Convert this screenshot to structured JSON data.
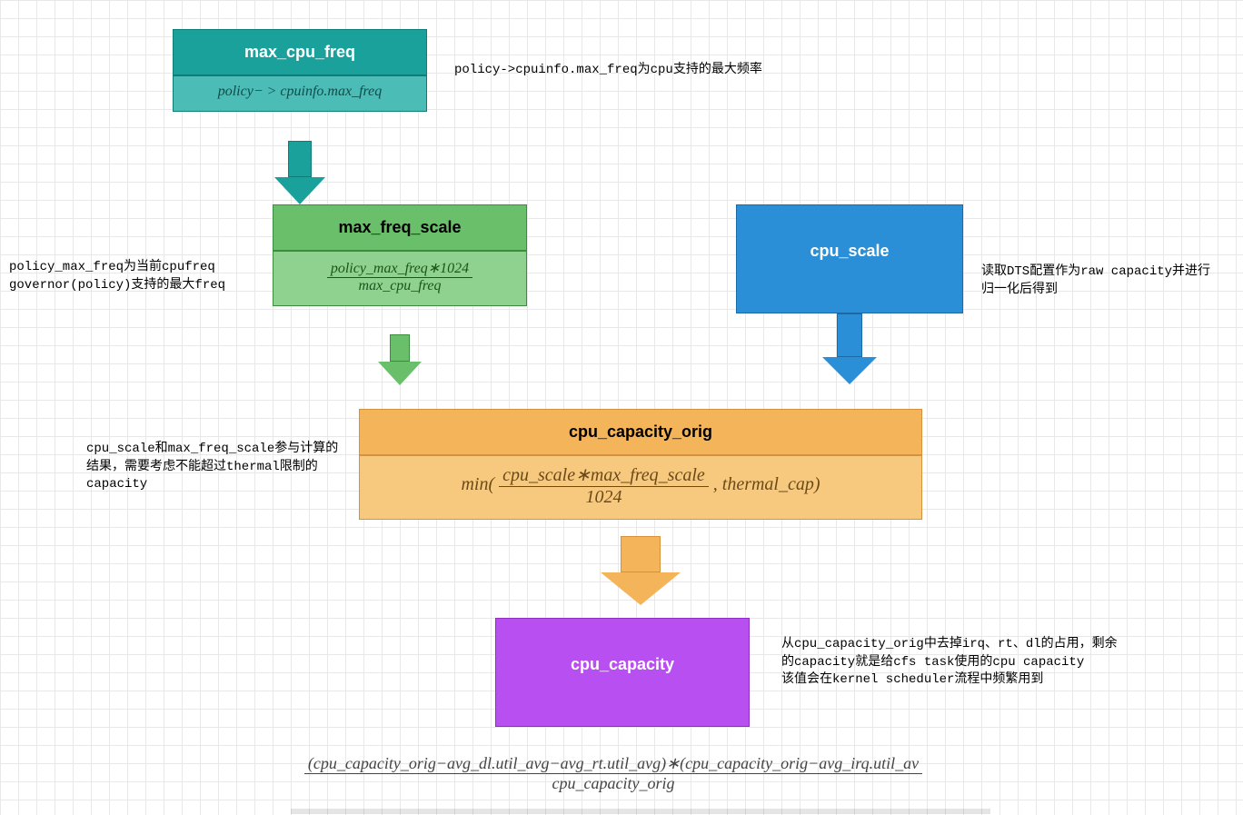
{
  "nodes": {
    "max_cpu_freq": {
      "title": "max_cpu_freq",
      "formula_num": "policy− > cpuinfo.max_freq"
    },
    "max_freq_scale": {
      "title": "max_freq_scale",
      "formula_num": "policy_max_freq∗1024",
      "formula_den": "max_cpu_freq"
    },
    "cpu_scale": {
      "title": "cpu_scale"
    },
    "cpu_capacity_orig": {
      "title": "cpu_capacity_orig",
      "formula_prefix": "min(",
      "formula_num": "cpu_scale∗max_freq_scale",
      "formula_den": "1024",
      "formula_suffix": ", thermal_cap)"
    },
    "cpu_capacity": {
      "title": "cpu_capacity"
    }
  },
  "annotations": {
    "a1": "policy->cpuinfo.max_freq为cpu支持的最大频率",
    "a2": "policy_max_freq为当前cpufreq governor(policy)支持的最大freq",
    "a3": "读取DTS配置作为raw capacity并进行归一化后得到",
    "a4": "cpu_scale和max_freq_scale参与计算的结果，需要考虑不能超过thermal限制的capacity",
    "a5": "从cpu_capacity_orig中去掉irq、rt、dl的占用，剩余的capacity就是给cfs task使用的cpu capacity\n该值会在kernel scheduler流程中频繁用到"
  },
  "bottom_formula": {
    "num": "(cpu_capacity_orig−avg_dl.util_avg−avg_rt.util_avg)∗(cpu_capacity_orig−avg_irq.util_av",
    "den": "cpu_capacity_orig"
  }
}
